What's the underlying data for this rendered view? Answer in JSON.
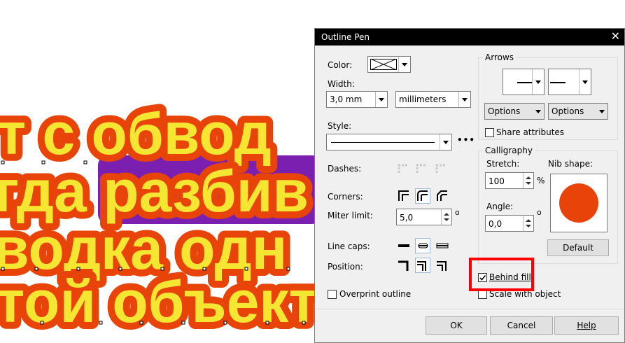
{
  "canvas": {
    "lines": [
      "т с обвод",
      "гда разбив",
      "водка одн",
      "той объект"
    ],
    "fill_color": "#f5e631",
    "outline_color": "#e8440a",
    "highlight_bg": "#7a1fb0"
  },
  "dialog": {
    "title": "Outline Pen",
    "color_label": "Color:",
    "width_label": "Width:",
    "width_value": "3,0 mm",
    "units_value": "millimeters",
    "style_label": "Style:",
    "dashes_label": "Dashes:",
    "corners_label": "Corners:",
    "miter_label": "Miter limit:",
    "miter_value": "5,0",
    "miter_unit": "o",
    "linecaps_label": "Line caps:",
    "position_label": "Position:",
    "overprint_label": "Overprint outline",
    "arrows_group": "Arrows",
    "options_left": "Options",
    "options_right": "Options",
    "share_attr": "Share attributes",
    "calligraphy_group": "Calligraphy",
    "stretch_label": "Stretch:",
    "stretch_value": "100",
    "stretch_unit": "%",
    "nib_label": "Nib shape:",
    "angle_label": "Angle:",
    "angle_value": "0,0",
    "angle_unit": "o",
    "default_btn": "Default",
    "behind_fill": "Behind fill",
    "scale_object": "Scale with object",
    "ok": "OK",
    "cancel": "Cancel",
    "help": "Help",
    "nib_color": "#e8440a"
  }
}
